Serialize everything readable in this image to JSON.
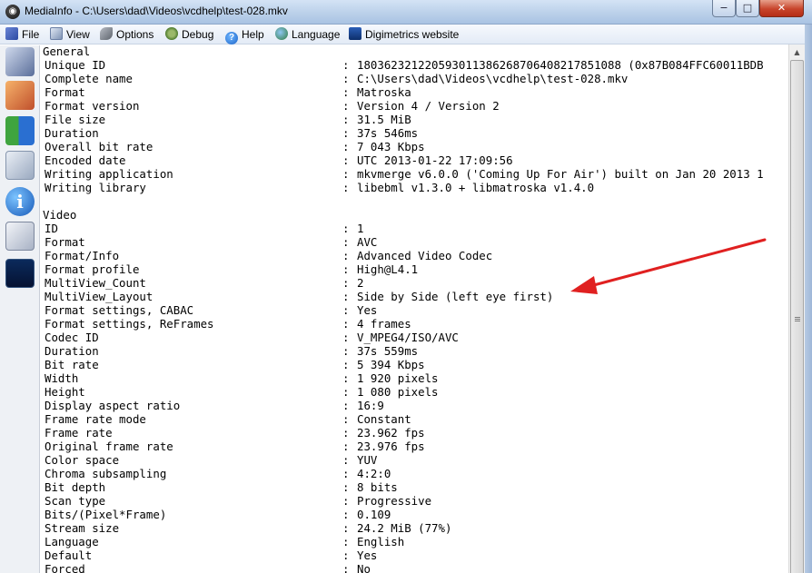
{
  "window": {
    "title": "MediaInfo - C:\\Users\\dad\\Videos\\vcdhelp\\test-028.mkv",
    "app_icon_glyph": "◉",
    "controls": {
      "minimize": "−",
      "maximize": "□",
      "close": "✕"
    }
  },
  "menu": {
    "items": [
      {
        "label": "File",
        "icon": "file-icon"
      },
      {
        "label": "View",
        "icon": "view-icon"
      },
      {
        "label": "Options",
        "icon": "options-icon"
      },
      {
        "label": "Debug",
        "icon": "debug-icon"
      },
      {
        "label": "Help",
        "icon": "help-icon"
      },
      {
        "label": "Language",
        "icon": "language-icon"
      },
      {
        "label": "Digimetrics website",
        "icon": "digimetrics-icon"
      }
    ]
  },
  "sidebar": {
    "icons": [
      "basic-view-icon",
      "sheet-view-icon",
      "tree-view-icon",
      "text-view-icon",
      "info-icon",
      "html-view-icon",
      "graph-view-icon"
    ],
    "info_glyph": "i"
  },
  "report": {
    "separator": ":",
    "sections": [
      {
        "title": "General",
        "fields": [
          {
            "key": "Unique ID",
            "value": "180362321220593011386268706408217851088 (0x87B084FFC60011BDB"
          },
          {
            "key": "Complete name",
            "value": "C:\\Users\\dad\\Videos\\vcdhelp\\test-028.mkv"
          },
          {
            "key": "Format",
            "value": "Matroska"
          },
          {
            "key": "Format version",
            "value": "Version 4 / Version 2"
          },
          {
            "key": "File size",
            "value": "31.5 MiB"
          },
          {
            "key": "Duration",
            "value": "37s 546ms"
          },
          {
            "key": "Overall bit rate",
            "value": "7 043 Kbps"
          },
          {
            "key": "Encoded date",
            "value": "UTC 2013-01-22 17:09:56"
          },
          {
            "key": "Writing application",
            "value": "mkvmerge v6.0.0 ('Coming Up For Air') built on Jan 20 2013 1"
          },
          {
            "key": "Writing library",
            "value": "libebml v1.3.0 + libmatroska v1.4.0"
          }
        ]
      },
      {
        "title": "Video",
        "fields": [
          {
            "key": "ID",
            "value": "1"
          },
          {
            "key": "Format",
            "value": "AVC"
          },
          {
            "key": "Format/Info",
            "value": "Advanced Video Codec"
          },
          {
            "key": "Format profile",
            "value": "High@L4.1"
          },
          {
            "key": "MultiView_Count",
            "value": "2"
          },
          {
            "key": "MultiView_Layout",
            "value": "Side by Side (left eye first)"
          },
          {
            "key": "Format settings, CABAC",
            "value": "Yes"
          },
          {
            "key": "Format settings, ReFrames",
            "value": "4 frames"
          },
          {
            "key": "Codec ID",
            "value": "V_MPEG4/ISO/AVC"
          },
          {
            "key": "Duration",
            "value": "37s 559ms"
          },
          {
            "key": "Bit rate",
            "value": "5 394 Kbps"
          },
          {
            "key": "Width",
            "value": "1 920 pixels"
          },
          {
            "key": "Height",
            "value": "1 080 pixels"
          },
          {
            "key": "Display aspect ratio",
            "value": "16:9"
          },
          {
            "key": "Frame rate mode",
            "value": "Constant"
          },
          {
            "key": "Frame rate",
            "value": "23.962 fps"
          },
          {
            "key": "Original frame rate",
            "value": "23.976 fps"
          },
          {
            "key": "Color space",
            "value": "YUV"
          },
          {
            "key": "Chroma subsampling",
            "value": "4:2:0"
          },
          {
            "key": "Bit depth",
            "value": "8 bits"
          },
          {
            "key": "Scan type",
            "value": "Progressive"
          },
          {
            "key": "Bits/(Pixel*Frame)",
            "value": "0.109"
          },
          {
            "key": "Stream size",
            "value": "24.2 MiB (77%)"
          },
          {
            "key": "Language",
            "value": "English"
          },
          {
            "key": "Default",
            "value": "Yes"
          },
          {
            "key": "Forced",
            "value": "No"
          }
        ]
      }
    ]
  },
  "scrollbar": {
    "up_glyph": "▲"
  },
  "annotation": {
    "arrow_color": "#e02020"
  }
}
